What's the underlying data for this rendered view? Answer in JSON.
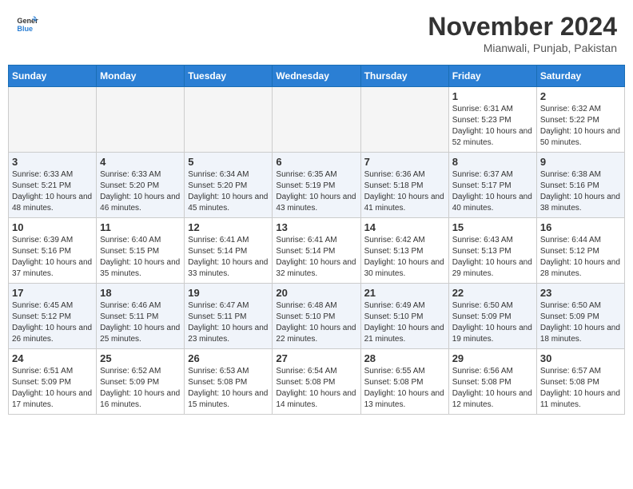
{
  "header": {
    "logo_line1": "General",
    "logo_line2": "Blue",
    "month": "November 2024",
    "location": "Mianwali, Punjab, Pakistan"
  },
  "weekdays": [
    "Sunday",
    "Monday",
    "Tuesday",
    "Wednesday",
    "Thursday",
    "Friday",
    "Saturday"
  ],
  "weeks": [
    [
      {
        "day": "",
        "info": ""
      },
      {
        "day": "",
        "info": ""
      },
      {
        "day": "",
        "info": ""
      },
      {
        "day": "",
        "info": ""
      },
      {
        "day": "",
        "info": ""
      },
      {
        "day": "1",
        "info": "Sunrise: 6:31 AM\nSunset: 5:23 PM\nDaylight: 10 hours and 52 minutes."
      },
      {
        "day": "2",
        "info": "Sunrise: 6:32 AM\nSunset: 5:22 PM\nDaylight: 10 hours and 50 minutes."
      }
    ],
    [
      {
        "day": "3",
        "info": "Sunrise: 6:33 AM\nSunset: 5:21 PM\nDaylight: 10 hours and 48 minutes."
      },
      {
        "day": "4",
        "info": "Sunrise: 6:33 AM\nSunset: 5:20 PM\nDaylight: 10 hours and 46 minutes."
      },
      {
        "day": "5",
        "info": "Sunrise: 6:34 AM\nSunset: 5:20 PM\nDaylight: 10 hours and 45 minutes."
      },
      {
        "day": "6",
        "info": "Sunrise: 6:35 AM\nSunset: 5:19 PM\nDaylight: 10 hours and 43 minutes."
      },
      {
        "day": "7",
        "info": "Sunrise: 6:36 AM\nSunset: 5:18 PM\nDaylight: 10 hours and 41 minutes."
      },
      {
        "day": "8",
        "info": "Sunrise: 6:37 AM\nSunset: 5:17 PM\nDaylight: 10 hours and 40 minutes."
      },
      {
        "day": "9",
        "info": "Sunrise: 6:38 AM\nSunset: 5:16 PM\nDaylight: 10 hours and 38 minutes."
      }
    ],
    [
      {
        "day": "10",
        "info": "Sunrise: 6:39 AM\nSunset: 5:16 PM\nDaylight: 10 hours and 37 minutes."
      },
      {
        "day": "11",
        "info": "Sunrise: 6:40 AM\nSunset: 5:15 PM\nDaylight: 10 hours and 35 minutes."
      },
      {
        "day": "12",
        "info": "Sunrise: 6:41 AM\nSunset: 5:14 PM\nDaylight: 10 hours and 33 minutes."
      },
      {
        "day": "13",
        "info": "Sunrise: 6:41 AM\nSunset: 5:14 PM\nDaylight: 10 hours and 32 minutes."
      },
      {
        "day": "14",
        "info": "Sunrise: 6:42 AM\nSunset: 5:13 PM\nDaylight: 10 hours and 30 minutes."
      },
      {
        "day": "15",
        "info": "Sunrise: 6:43 AM\nSunset: 5:13 PM\nDaylight: 10 hours and 29 minutes."
      },
      {
        "day": "16",
        "info": "Sunrise: 6:44 AM\nSunset: 5:12 PM\nDaylight: 10 hours and 28 minutes."
      }
    ],
    [
      {
        "day": "17",
        "info": "Sunrise: 6:45 AM\nSunset: 5:12 PM\nDaylight: 10 hours and 26 minutes."
      },
      {
        "day": "18",
        "info": "Sunrise: 6:46 AM\nSunset: 5:11 PM\nDaylight: 10 hours and 25 minutes."
      },
      {
        "day": "19",
        "info": "Sunrise: 6:47 AM\nSunset: 5:11 PM\nDaylight: 10 hours and 23 minutes."
      },
      {
        "day": "20",
        "info": "Sunrise: 6:48 AM\nSunset: 5:10 PM\nDaylight: 10 hours and 22 minutes."
      },
      {
        "day": "21",
        "info": "Sunrise: 6:49 AM\nSunset: 5:10 PM\nDaylight: 10 hours and 21 minutes."
      },
      {
        "day": "22",
        "info": "Sunrise: 6:50 AM\nSunset: 5:09 PM\nDaylight: 10 hours and 19 minutes."
      },
      {
        "day": "23",
        "info": "Sunrise: 6:50 AM\nSunset: 5:09 PM\nDaylight: 10 hours and 18 minutes."
      }
    ],
    [
      {
        "day": "24",
        "info": "Sunrise: 6:51 AM\nSunset: 5:09 PM\nDaylight: 10 hours and 17 minutes."
      },
      {
        "day": "25",
        "info": "Sunrise: 6:52 AM\nSunset: 5:09 PM\nDaylight: 10 hours and 16 minutes."
      },
      {
        "day": "26",
        "info": "Sunrise: 6:53 AM\nSunset: 5:08 PM\nDaylight: 10 hours and 15 minutes."
      },
      {
        "day": "27",
        "info": "Sunrise: 6:54 AM\nSunset: 5:08 PM\nDaylight: 10 hours and 14 minutes."
      },
      {
        "day": "28",
        "info": "Sunrise: 6:55 AM\nSunset: 5:08 PM\nDaylight: 10 hours and 13 minutes."
      },
      {
        "day": "29",
        "info": "Sunrise: 6:56 AM\nSunset: 5:08 PM\nDaylight: 10 hours and 12 minutes."
      },
      {
        "day": "30",
        "info": "Sunrise: 6:57 AM\nSunset: 5:08 PM\nDaylight: 10 hours and 11 minutes."
      }
    ]
  ]
}
